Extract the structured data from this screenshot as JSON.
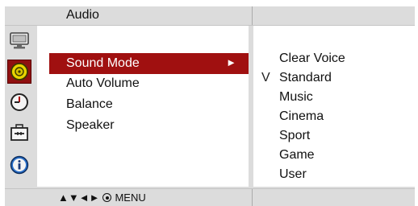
{
  "header": {
    "title": "Audio"
  },
  "sidebar": {
    "icons": [
      {
        "name": "picture-icon",
        "active": false
      },
      {
        "name": "audio-icon",
        "active": true
      },
      {
        "name": "time-icon",
        "active": false
      },
      {
        "name": "option-icon",
        "active": false
      },
      {
        "name": "information-icon",
        "active": false
      }
    ]
  },
  "menu": {
    "items": [
      {
        "label": "Sound Mode",
        "selected": true,
        "arrow": "►"
      },
      {
        "label": "Auto Volume",
        "selected": false
      },
      {
        "label": "Balance",
        "selected": false
      },
      {
        "label": "Speaker",
        "selected": false
      }
    ]
  },
  "submenu": {
    "check_mark": "V",
    "items": [
      {
        "label": "Clear Voice",
        "checked": false
      },
      {
        "label": "Standard",
        "checked": true
      },
      {
        "label": "Music",
        "checked": false
      },
      {
        "label": "Cinema",
        "checked": false
      },
      {
        "label": "Sport",
        "checked": false
      },
      {
        "label": "Game",
        "checked": false
      },
      {
        "label": "User",
        "checked": false
      }
    ]
  },
  "footer": {
    "nav_arrows": "▲▼◄►",
    "menu_label": "MENU"
  },
  "colors": {
    "highlight": "#a01010",
    "panel": "#ffffff",
    "frame": "#dcdcdc"
  }
}
